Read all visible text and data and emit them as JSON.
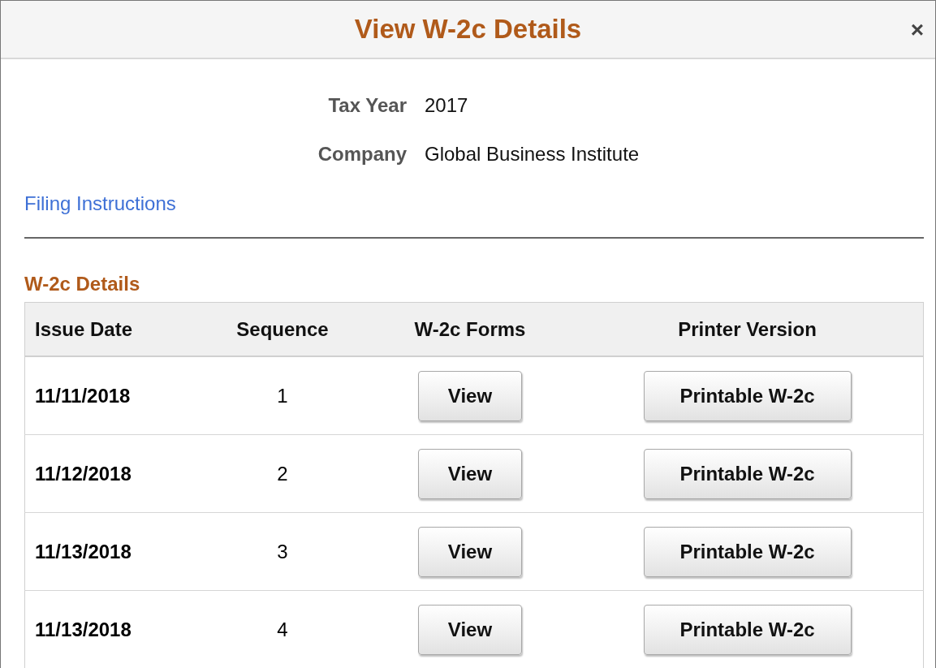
{
  "window": {
    "title": "View W-2c Details",
    "close": "×"
  },
  "fields": [
    {
      "label": "Tax Year",
      "value": "2017"
    },
    {
      "label": "Company",
      "value": "Global Business Institute"
    }
  ],
  "link": "Filing Instructions",
  "section_title": "W-2c Details",
  "table": {
    "columns": [
      "Issue Date",
      "Sequence",
      "W-2c Forms",
      "Printer Version"
    ],
    "rows": [
      {
        "issue_date": "11/11/2018",
        "sequence": "1",
        "form_button": "View",
        "print_button": "Printable W-2c"
      },
      {
        "issue_date": "11/12/2018",
        "sequence": "2",
        "form_button": "View",
        "print_button": "Printable W-2c"
      },
      {
        "issue_date": "11/13/2018",
        "sequence": "3",
        "form_button": "View",
        "print_button": "Printable W-2c"
      },
      {
        "issue_date": "11/13/2018",
        "sequence": "4",
        "form_button": "View",
        "print_button": "Printable W-2c"
      }
    ]
  }
}
